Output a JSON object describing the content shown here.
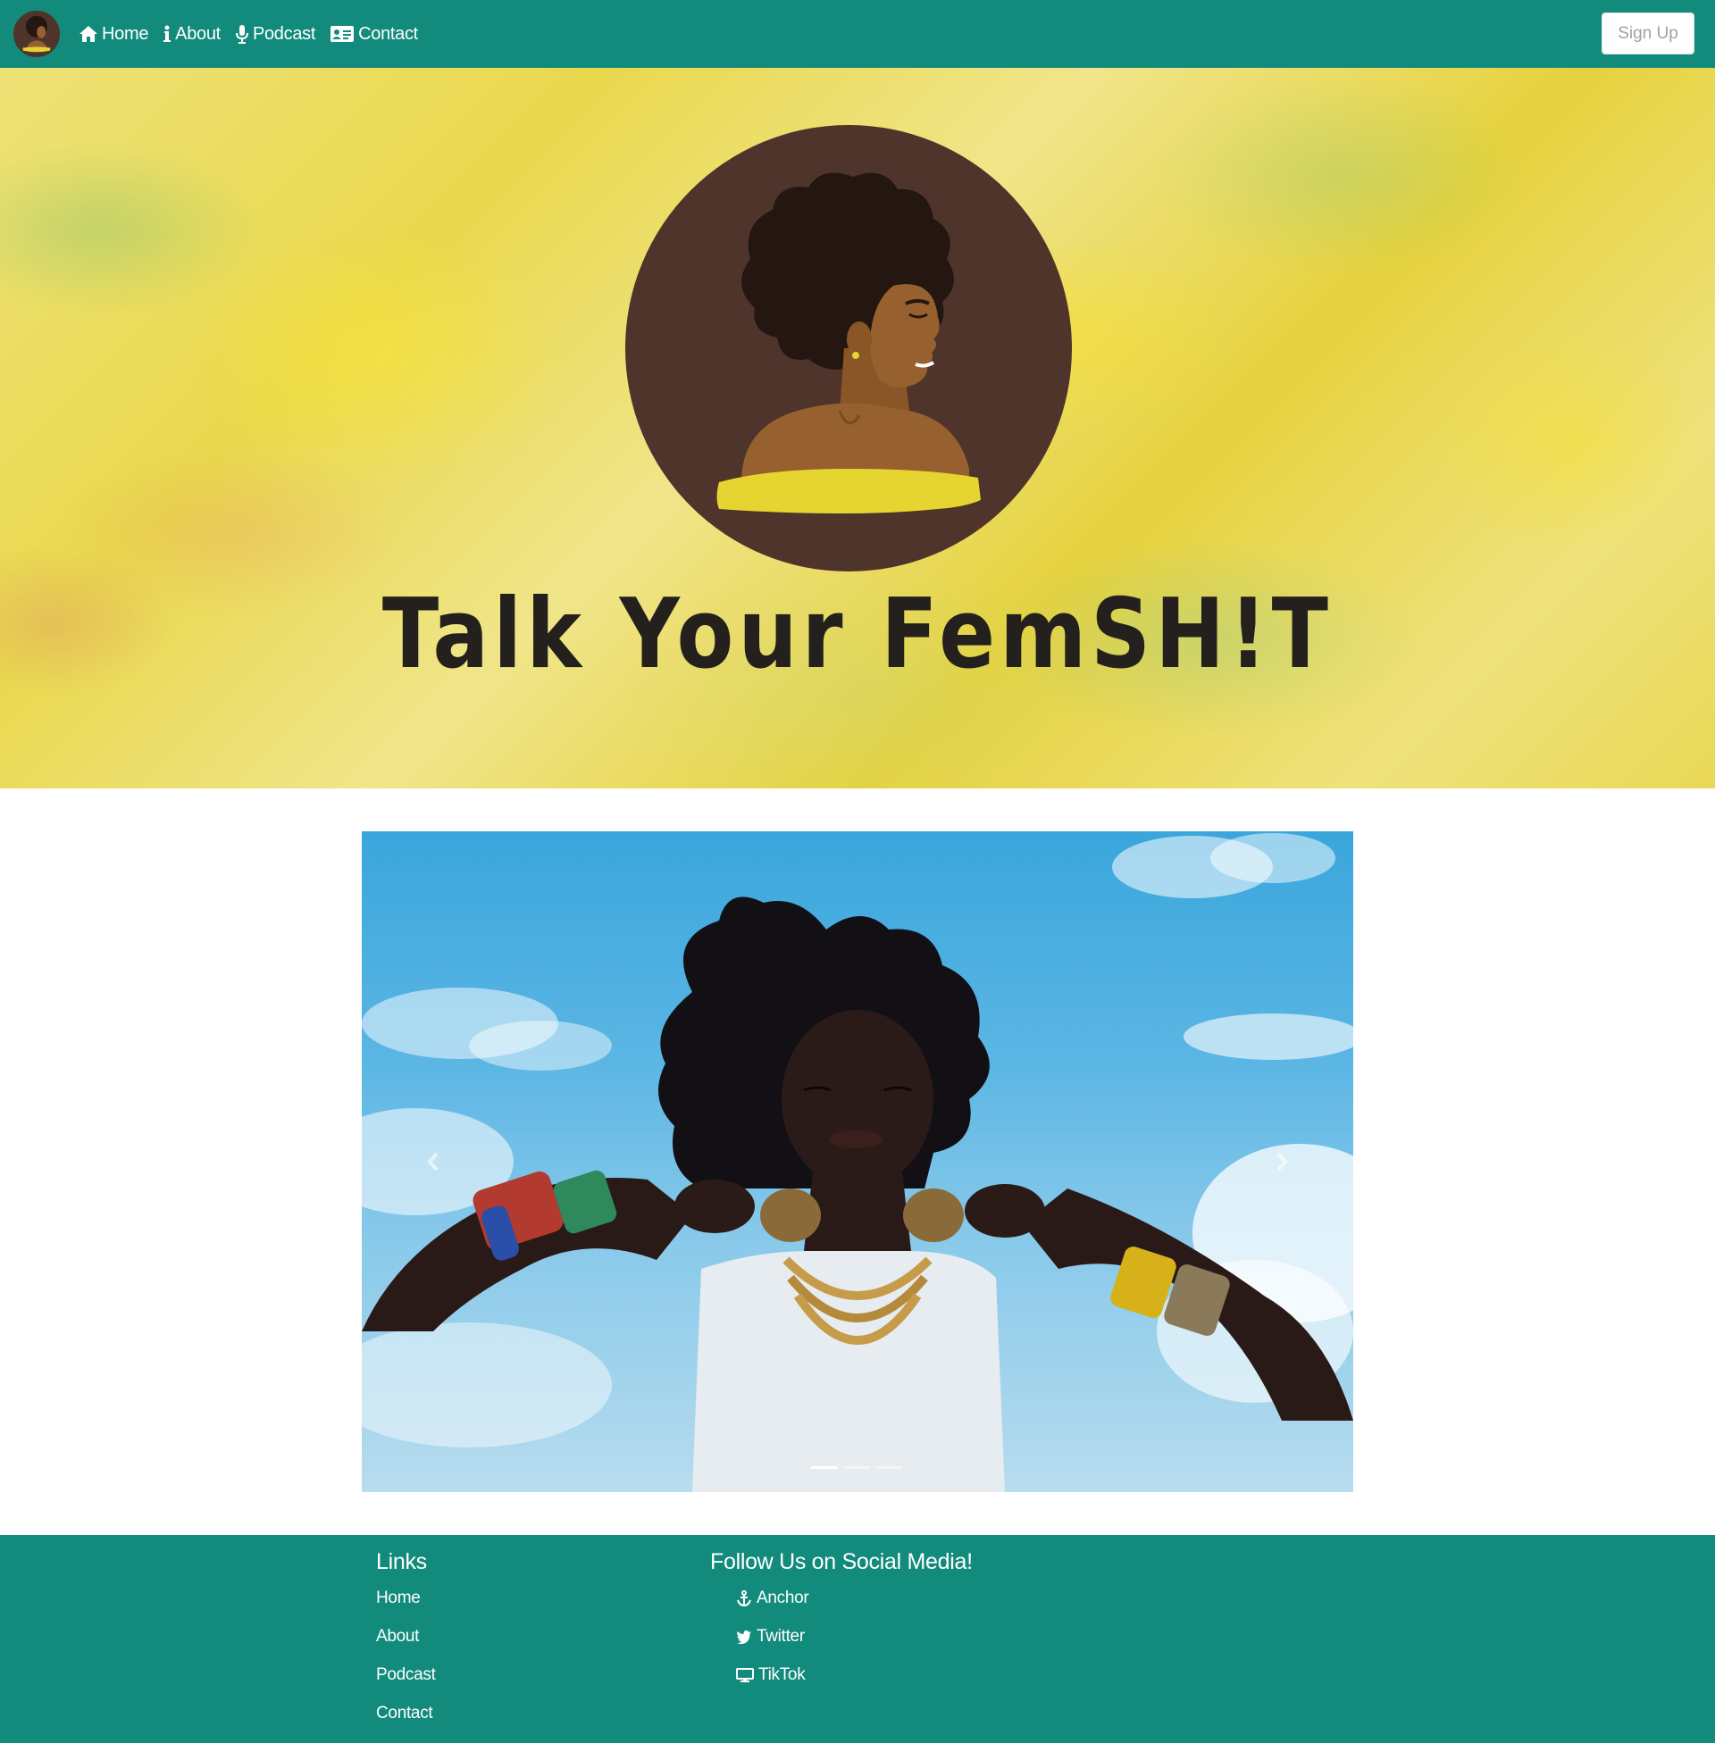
{
  "navbar": {
    "links": [
      {
        "label": "Home",
        "icon": "home-icon"
      },
      {
        "label": "About",
        "icon": "info-icon"
      },
      {
        "label": "Podcast",
        "icon": "microphone-icon"
      },
      {
        "label": "Contact",
        "icon": "address-card-icon"
      }
    ],
    "signup_label": "Sign Up"
  },
  "hero": {
    "title": "Talk Your FemSH!T"
  },
  "carousel": {
    "slide_count": 3,
    "active_index": 0
  },
  "footer": {
    "links_heading": "Links",
    "links": [
      "Home",
      "About",
      "Podcast",
      "Contact"
    ],
    "social_heading": "Follow Us on Social Media!",
    "social": [
      {
        "label": "Anchor",
        "icon": "anchor-icon"
      },
      {
        "label": "Twitter",
        "icon": "twitter-icon"
      },
      {
        "label": "TikTok",
        "icon": "desktop-icon"
      }
    ]
  },
  "colors": {
    "teal": "#128b7c",
    "avatar_brown": "#4e342b",
    "top_yellow": "#e6d530",
    "title_dark": "#23201d"
  }
}
